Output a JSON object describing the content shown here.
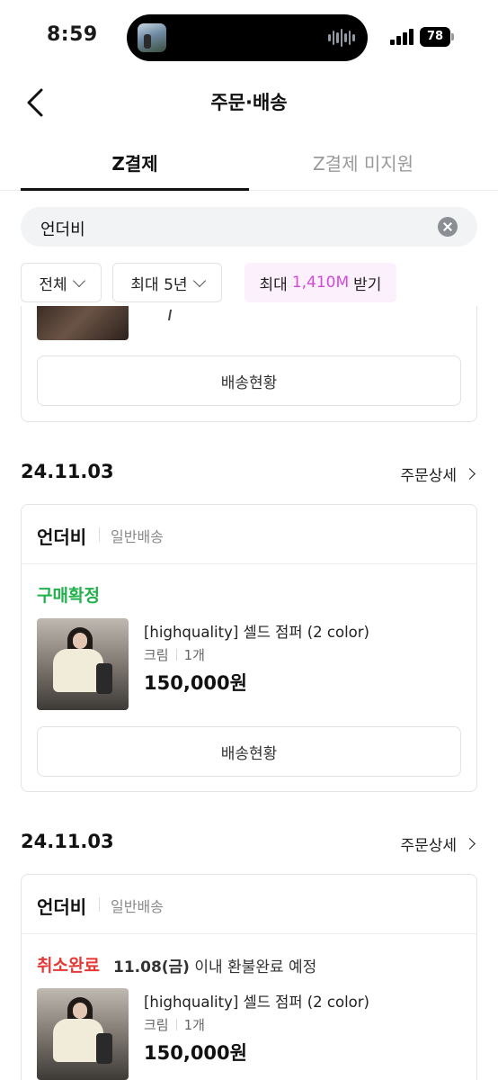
{
  "status_bar": {
    "time": "8:59",
    "battery": "78"
  },
  "header": {
    "title": "주문·배송"
  },
  "tabs": [
    {
      "label": "Z결제"
    },
    {
      "label": "Z결제 미지원"
    }
  ],
  "search": {
    "value": "언더비"
  },
  "filters": {
    "all_label": "전체",
    "period_label": "최대 5년",
    "promo_prefix": "최대",
    "promo_highlight": "1,410M",
    "promo_suffix": "받기"
  },
  "top_card": {
    "track_label": "배송현황"
  },
  "orders": [
    {
      "date": "24.11.03",
      "detail_label": "주문상세",
      "shop": "언더비",
      "ship_type": "일반배송",
      "status": "구매확정",
      "product_name": "[highquality] 셀드 점퍼 (2 color)",
      "option": "크림",
      "quantity": "1개",
      "price": "150,000원",
      "track_label": "배송현황"
    },
    {
      "date": "24.11.03",
      "detail_label": "주문상세",
      "shop": "언더비",
      "ship_type": "일반배송",
      "status": "취소완료",
      "refund_date": "11.08(금)",
      "refund_text": "이내 환불완료 예정",
      "product_name": "[highquality] 셀드 점퍼 (2 color)",
      "option": "크림",
      "quantity": "1개",
      "price": "150,000원"
    }
  ],
  "colors": {
    "confirm": "#22b14c",
    "cancel": "#e53935",
    "promo_accent": "#d14bd8",
    "promo_bg": "#fbf0fb"
  }
}
